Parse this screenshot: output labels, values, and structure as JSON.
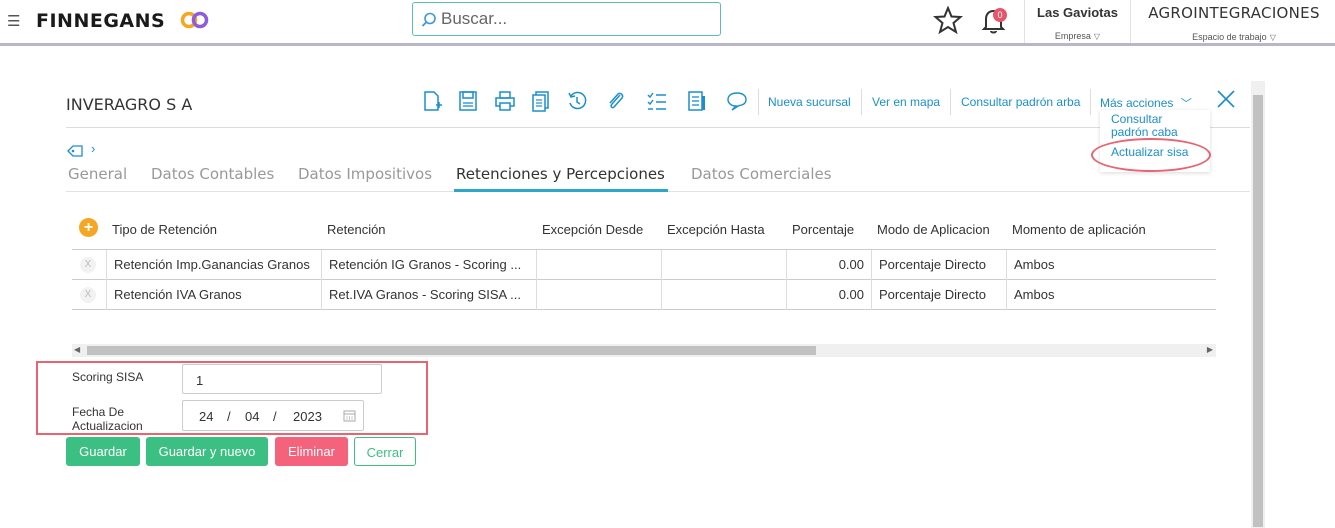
{
  "topbar": {
    "logo": "FINNEGANS",
    "search_placeholder": "Buscar...",
    "notifications_count": "0",
    "company": {
      "name": "Las Gaviotas",
      "label": "Empresa"
    },
    "workspace": {
      "name": "AGROINTEGRACIONES",
      "label": "Espacio de trabajo"
    }
  },
  "record": {
    "title": "INVERAGRO S A",
    "toolbar_links": [
      "Nueva sucursal",
      "Ver en mapa",
      "Consultar padrón arba",
      "Más acciones"
    ],
    "toolbar_icons": [
      "new-document-icon",
      "save-icon",
      "print-icon",
      "copy-icon",
      "history-icon",
      "attachment-icon",
      "checklist-icon",
      "report-icon",
      "comment-icon"
    ]
  },
  "more_actions_menu": {
    "items": [
      "Consultar padrón caba",
      "Actualizar sisa"
    ]
  },
  "tabs": [
    "General",
    "Datos Contables",
    "Datos Impositivos",
    "Retenciones y Percepciones",
    "Datos Comerciales"
  ],
  "active_tab": "Retenciones y Percepciones",
  "table": {
    "columns": [
      "Tipo de Retención",
      "Retención",
      "Excepción Desde",
      "Excepción Hasta",
      "Porcentaje",
      "Modo de Aplicacion",
      "Momento de aplicación"
    ],
    "rows": [
      [
        "Retención Imp.Ganancias Granos",
        "Retención IG Granos - Scoring ...",
        "",
        "",
        "0.00",
        "Porcentaje Directo",
        "Ambos"
      ],
      [
        "Retención IVA Granos",
        "Ret.IVA Granos - Scoring SISA ...",
        "",
        "",
        "0.00",
        "Porcentaje Directo",
        "Ambos"
      ]
    ]
  },
  "fields": {
    "scoring_label": "Scoring SISA",
    "scoring_value": "1",
    "fecha_label": "Fecha De Actualizacion",
    "fecha_day": "24",
    "fecha_month": "04",
    "fecha_year": "2023",
    "sep": "/"
  },
  "buttons": {
    "guardar": "Guardar",
    "guardar_nuevo": "Guardar y nuevo",
    "eliminar": "Eliminar",
    "cerrar": "Cerrar"
  },
  "colors": {
    "accent": "#1a8fcf",
    "green": "#3cbf83",
    "red": "#f4627c",
    "highlight": "#e86470"
  }
}
